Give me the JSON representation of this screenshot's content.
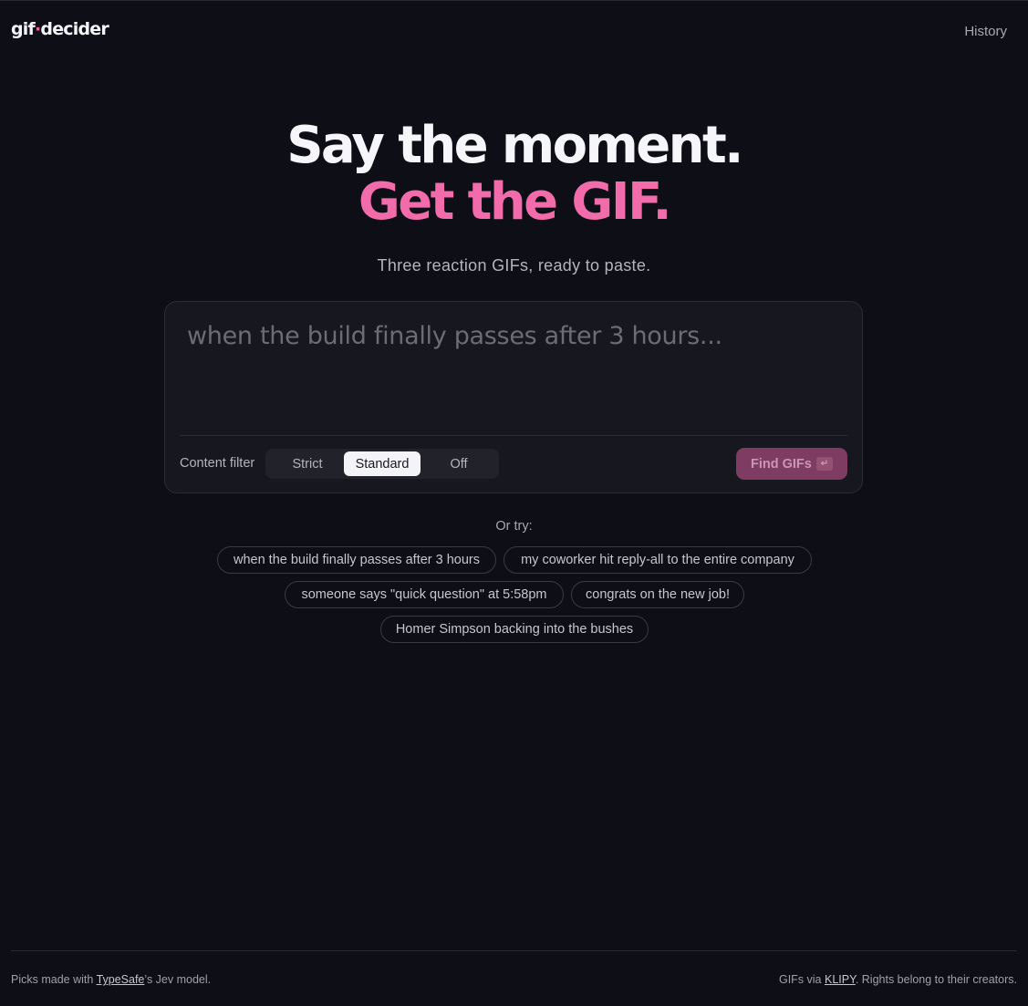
{
  "header": {
    "logo_text_a": "gif",
    "logo_text_dot": "·",
    "logo_text_b": "decider",
    "history_label": "History"
  },
  "hero": {
    "title_line1": "Say the moment.",
    "title_line2": "Get the GIF.",
    "subtitle": "Three reaction GIFs, ready to paste."
  },
  "composer": {
    "placeholder": "when the build finally passes after 3 hours...",
    "value": "",
    "content_filter_label": "Content filter",
    "filter_options": [
      "Strict",
      "Standard",
      "Off"
    ],
    "filter_selected": "Standard",
    "find_button_label": "Find GIFs",
    "find_button_key_hint": "↵",
    "find_button_enabled": false
  },
  "suggestions": {
    "label": "Or try:",
    "chips": [
      "when the build finally passes after 3 hours",
      "my coworker hit reply-all to the entire company",
      "someone says \"quick question\" at 5:58pm",
      "congrats on the new job!",
      "Homer Simpson backing into the bushes"
    ]
  },
  "footer": {
    "left_prefix": "Picks made with ",
    "left_link": "TypeSafe",
    "left_suffix": "’s Jev model.",
    "right_prefix": "GIFs via ",
    "right_link": "KLIPY",
    "right_suffix": ". Rights belong to their creators."
  },
  "colors": {
    "background": "#0e0e16",
    "accent_pink": "#f26bab",
    "card_bg": "#17171f"
  }
}
